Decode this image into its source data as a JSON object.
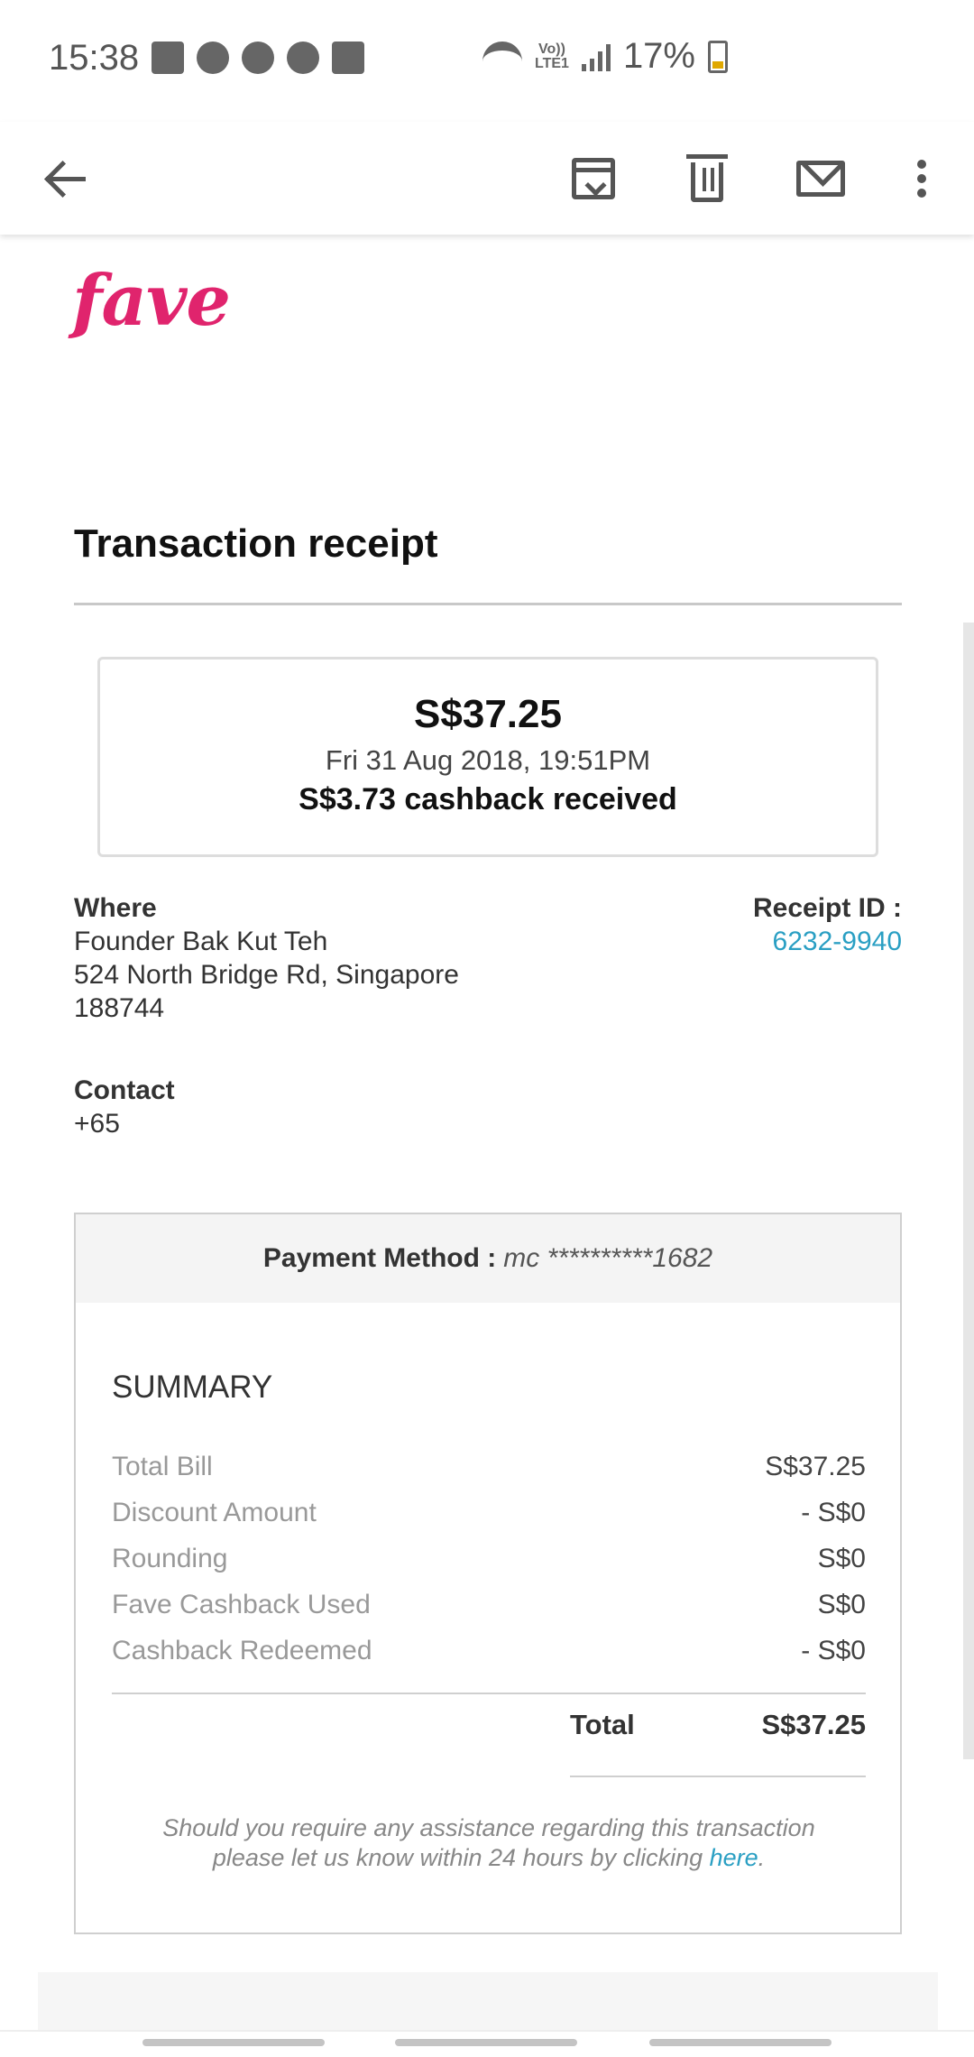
{
  "status_bar": {
    "time": "15:38",
    "battery_percent": "17%",
    "network_label_line1": "Vo))",
    "network_label_line2": "LTE1",
    "icons": [
      "gmail-icon",
      "messenger-icon",
      "whatsapp-icon",
      "app-icon",
      "gallery-icon",
      "wifi-icon",
      "signal-icon",
      "battery-icon"
    ]
  },
  "app_bar": {
    "icons": [
      "back-arrow-icon",
      "archive-icon",
      "delete-icon",
      "mail-icon",
      "more-vert-icon"
    ]
  },
  "email": {
    "logo_text": "fave",
    "title": "Transaction receipt",
    "amount": "S$37.25",
    "date": "Fri 31 Aug 2018, 19:51PM",
    "cashback": "S$3.73 cashback received",
    "where_label": "Where",
    "merchant_name": "Founder Bak Kut Teh",
    "address_line1": "524 North Bridge Rd, Singapore",
    "address_line2": "188744",
    "receipt_id_label": "Receipt ID :",
    "receipt_id_value": "6232-9940",
    "contact_label": "Contact",
    "contact_value": "+65",
    "payment_method_label": "Payment Method :",
    "payment_method_value": "mc **********1682",
    "summary_title": "SUMMARY",
    "summary_rows": [
      {
        "label": "Total Bill",
        "value": "S$37.25"
      },
      {
        "label": "Discount Amount",
        "value": "- S$0"
      },
      {
        "label": "Rounding",
        "value": "S$0"
      },
      {
        "label": "Fave Cashback Used",
        "value": "S$0"
      },
      {
        "label": "Cashback Redeemed",
        "value": "- S$0"
      }
    ],
    "total_label": "Total",
    "total_value": "S$37.25",
    "assist_line1": "Should you require any assistance regarding this transaction",
    "assist_line2": "please let us know within 24 hours by clicking",
    "assist_link": "here",
    "assist_end": "."
  },
  "colors": {
    "brand": "#e0246d",
    "link": "#2a9fc3"
  }
}
